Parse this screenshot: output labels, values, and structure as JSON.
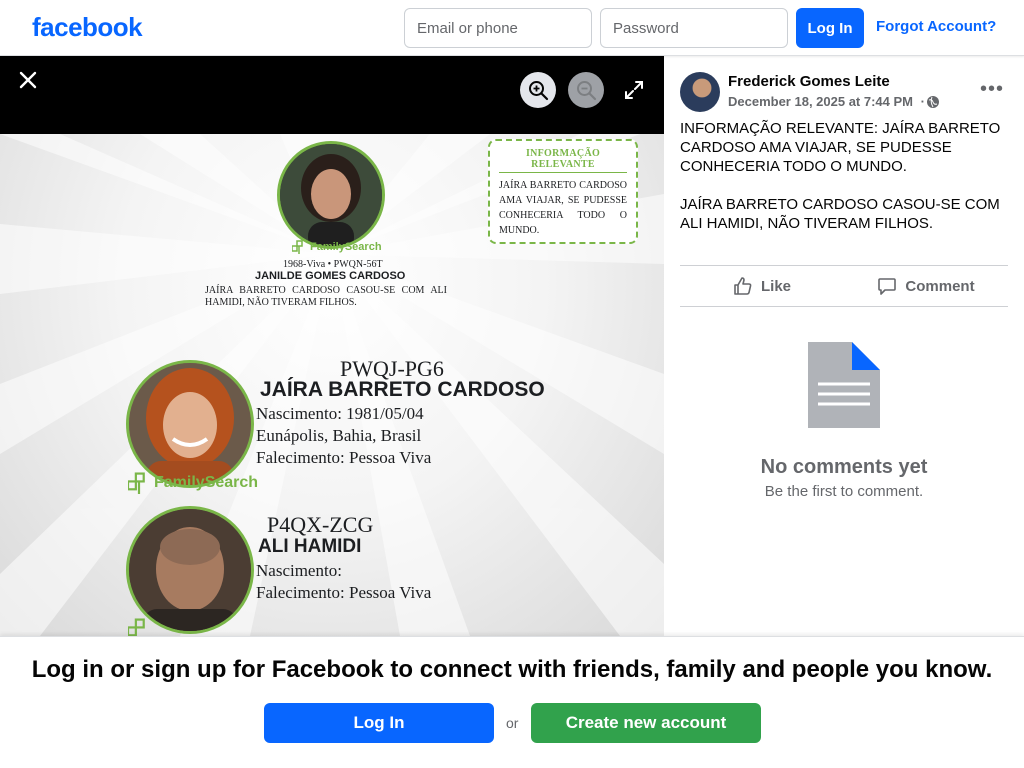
{
  "header": {
    "logo": "facebook",
    "email_placeholder": "Email or phone",
    "password_placeholder": "Password",
    "login_label": "Log In",
    "forgot_label": "Forgot Account?"
  },
  "viewer": {
    "close_icon": "close-icon",
    "zoom_in_icon": "zoom-in-icon",
    "zoom_out_icon": "zoom-out-icon",
    "fullscreen_icon": "fullscreen-icon"
  },
  "photo": {
    "top_person": {
      "logo": "FamilySearch",
      "meta": "1968-Viva • PWQN-56T",
      "name": "JANILDE GOMES CARDOSO",
      "description": "JAÍRA BARRETO CARDOSO CASOU-SE COM ALI HAMIDI, NÃO TIVERAM FILHOS."
    },
    "info_box": {
      "title": "INFORMAÇÃO RELEVANTE",
      "text": "JAÍRA BARRETO CARDOSO AMA VIAJAR, SE PUDESSE CONHECERIA TODO O MUNDO."
    },
    "person1": {
      "code": "PWQJ-PG6",
      "name": "JAÍRA BARRETO CARDOSO",
      "birth": "Nascimento: 1981/05/04",
      "place": "Eunápolis, Bahia, Brasil",
      "death": "Falecimento: Pessoa Viva",
      "logo": "FamilySearch"
    },
    "person2": {
      "code": "P4QX-ZCG",
      "name": "ALI HAMIDI",
      "birth": "Nascimento:",
      "death": "Falecimento: Pessoa Viva"
    }
  },
  "post": {
    "author": "Frederick Gomes Leite",
    "date": "December 18, 2025 at 7:44 PM",
    "date_separator": "·",
    "paragraphs": [
      "INFORMAÇÃO RELEVANTE: JAÍRA BARRETO CARDOSO AMA VIAJAR, SE PUDESSE CONHECERIA TODO O MUNDO.",
      "JAÍRA BARRETO CARDOSO CASOU-SE COM ALI HAMIDI, NÃO TIVERAM FILHOS."
    ],
    "like_label": "Like",
    "comment_label": "Comment",
    "more_label": "•••"
  },
  "comments": {
    "empty_title": "No comments yet",
    "empty_sub": "Be the first to comment."
  },
  "banner": {
    "text": "Log in or sign up for Facebook to connect with friends, family and people you know.",
    "login_label": "Log In",
    "or_label": "or",
    "create_label": "Create new account"
  },
  "colors": {
    "brand": "#0866ff",
    "create_green": "#31a24c",
    "familysearch_green": "#7ab648"
  }
}
